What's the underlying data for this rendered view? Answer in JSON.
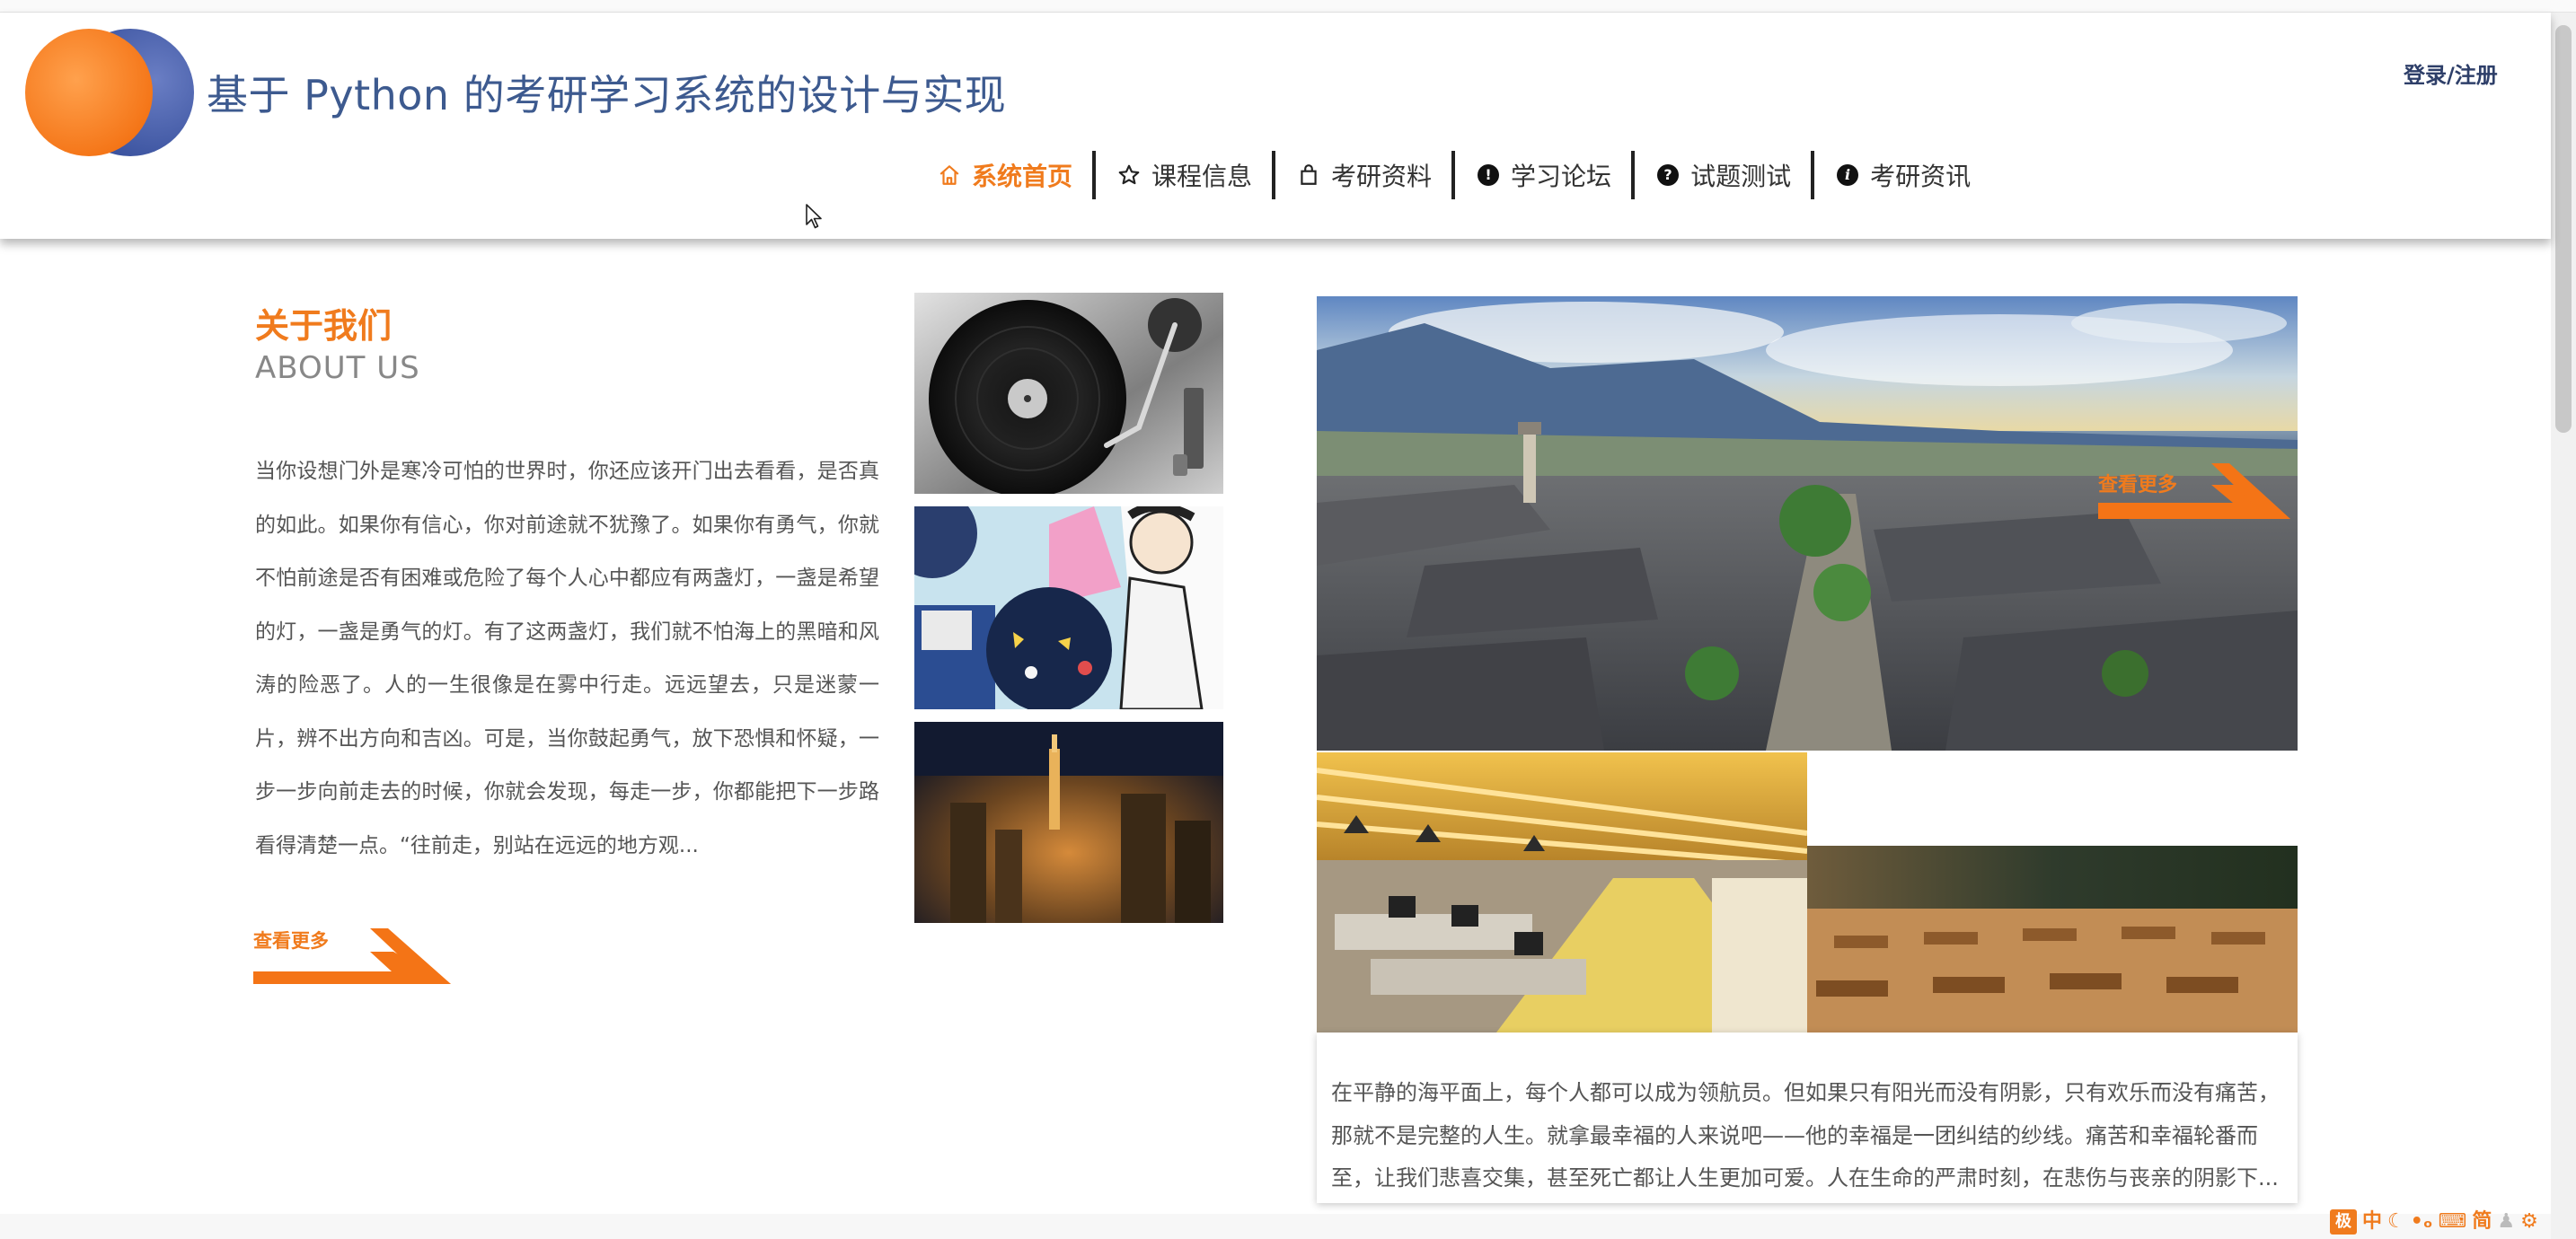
{
  "header": {
    "title": "基于 Python 的考研学习系统的设计与实现",
    "login_label": "登录/注册"
  },
  "nav": {
    "items": [
      {
        "label": "系统首页",
        "icon": "home-icon",
        "active": true
      },
      {
        "label": "课程信息",
        "icon": "star-icon",
        "active": false
      },
      {
        "label": "考研资料",
        "icon": "bag-icon",
        "active": false
      },
      {
        "label": "学习论坛",
        "icon": "exclamation-circle-icon",
        "active": false
      },
      {
        "label": "试题测试",
        "icon": "question-circle-icon",
        "active": false
      },
      {
        "label": "考研资讯",
        "icon": "info-circle-icon",
        "active": false
      }
    ]
  },
  "about": {
    "title": "关于我们",
    "subtitle": "ABOUT US",
    "text": "当你设想门外是寒冷可怕的世界时，你还应该开门出去看看，是否真的如此。如果你有信心，你对前途就不犹豫了。如果你有勇气，你就不怕前途是否有困难或危险了每个人心中都应有两盏灯，一盏是希望的灯，一盏是勇气的灯。有了这两盏灯，我们就不怕海上的黑暗和风涛的险恶了。人的一生很像是在雾中行走。远远望去，只是迷蒙一片，辨不出方向和吉凶。可是，当你鼓起勇气，放下恐惧和怀疑，一步一步向前走去的时候，你就会发现，每走一步，你都能把下一步路看得清楚一点。“往前走，别站在远远的地方观...",
    "more_label": "查看更多"
  },
  "gallery": {
    "overlay_more_label": "查看更多",
    "caption": "在平静的海平面上，每个人都可以成为领航员。但如果只有阳光而没有阴影，只有欢乐而没有痛苦，那就不是完整的人生。就拿最幸福的人来说吧——他的幸福是一团纠结的纱线。痛苦和幸福轮番而至，让我们悲喜交集，甚至死亡都让人生更加可爱。人在生命的严肃时刻，在悲伤与丧亲的阴影下..."
  },
  "ime": {
    "items": [
      "中",
      "简"
    ]
  },
  "colors": {
    "accent": "#f07b1d",
    "title_blue": "#3d5a8f",
    "logo_blue": "#3c54a0"
  }
}
